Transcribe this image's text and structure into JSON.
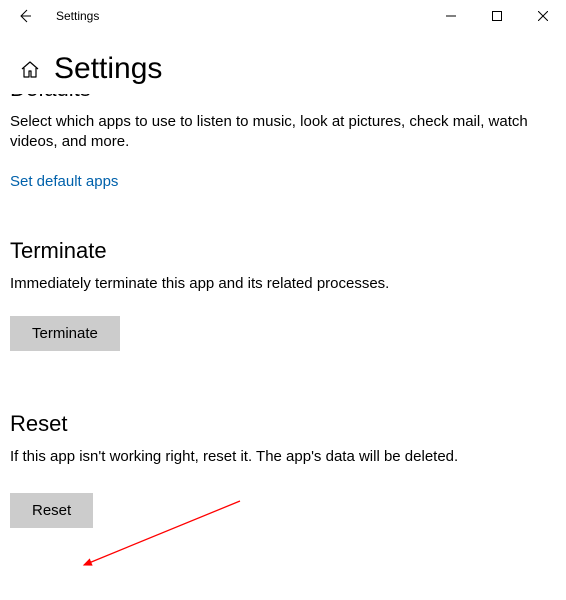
{
  "titlebar": {
    "title": "Settings"
  },
  "header": {
    "page_title": "Settings"
  },
  "defaults": {
    "heading": "Defaults",
    "description": "Select which apps to use to listen to music, look at pictures, check mail, watch videos, and more.",
    "link_label": "Set default apps"
  },
  "terminate": {
    "heading": "Terminate",
    "description": "Immediately terminate this app and its related processes.",
    "button_label": "Terminate"
  },
  "reset": {
    "heading": "Reset",
    "description": "If this app isn't working right, reset it. The app's data will be deleted.",
    "button_label": "Reset"
  },
  "colors": {
    "link": "#0061ab",
    "button_bg": "#cccccc",
    "arrow": "#ff0000"
  }
}
